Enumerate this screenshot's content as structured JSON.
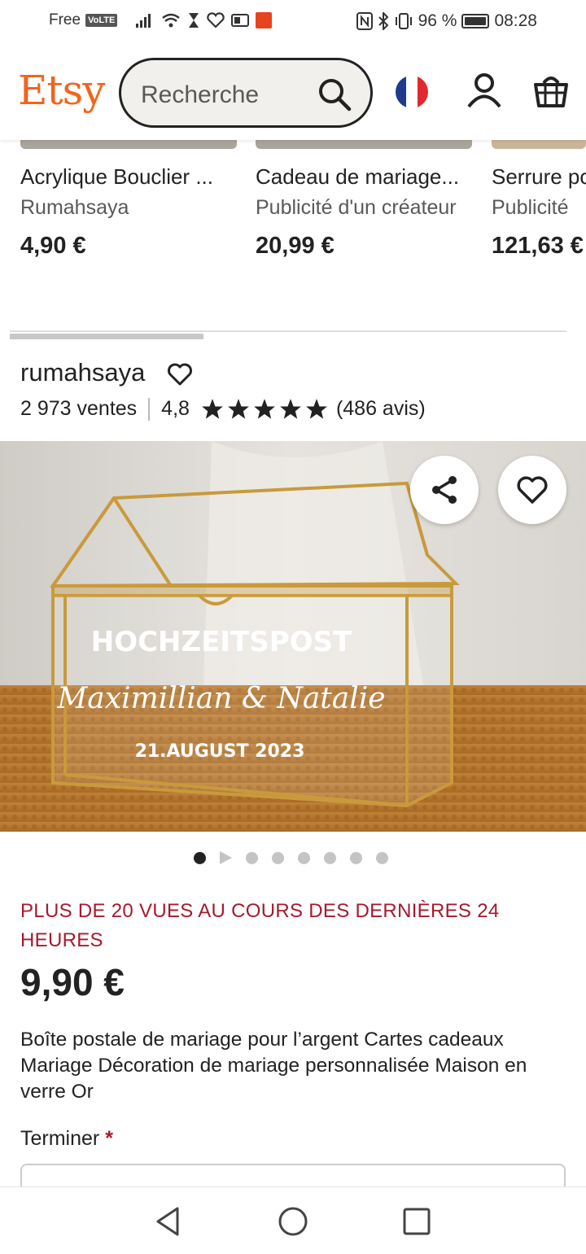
{
  "status_bar": {
    "carrier": "Free",
    "volte": "VoLTE",
    "battery": "96 %",
    "time": "08:28"
  },
  "header": {
    "logo": "Etsy",
    "search_placeholder": "Recherche",
    "brand_color": "#f1641e"
  },
  "related_products": [
    {
      "title": "Acrylique Bouclier ...",
      "shop": "Rumahsaya",
      "price": "4,90 €"
    },
    {
      "title": "Cadeau de mariage...",
      "shop": "Publicité d'un créateur",
      "price": "20,99 €"
    },
    {
      "title": "Serrure pour...",
      "shop": "Publicité",
      "price": "121,63 €"
    }
  ],
  "shop": {
    "name": "rumahsaya",
    "sales": "2 973 ventes",
    "rating": "4,8",
    "stars": 5,
    "reviews": "(486 avis)"
  },
  "image": {
    "engraving_title": "HOCHZEITSPOST",
    "engraving_names": "Maximillian & Natalie",
    "engraving_date": "21.AUGUST 2023",
    "slide_count": 8,
    "active_slide": 1
  },
  "listing": {
    "views_notice": "PLUS DE 20 VUES AU COURS DES DERNIÈRES 24 HEURES",
    "price": "9,90 €",
    "title": "Boîte postale de mariage pour l’argent Cartes cadeaux Mariage Décoration de mariage personnalisée Maison en verre Or",
    "option_label": "Terminer",
    "required_mark": "*"
  }
}
